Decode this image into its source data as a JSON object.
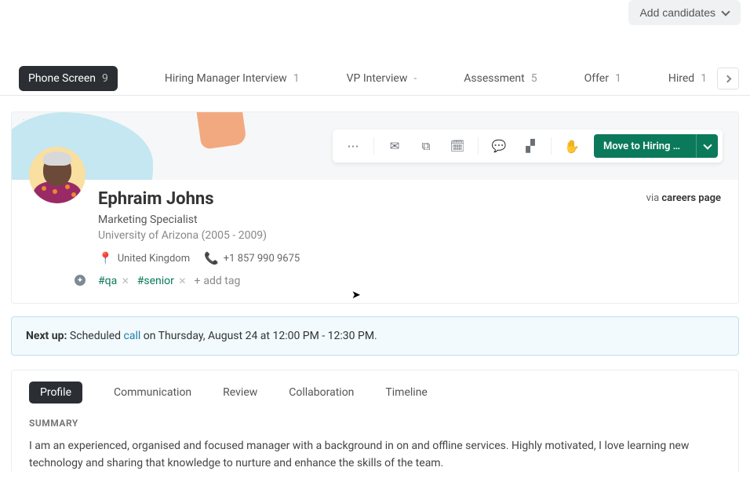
{
  "topbar": {
    "add_candidates_label": "Add candidates"
  },
  "pipeline": {
    "stages": [
      {
        "label": "Phone Screen",
        "count": "9",
        "active": true
      },
      {
        "label": "Hiring Manager Interview",
        "count": "1",
        "active": false
      },
      {
        "label": "VP Interview",
        "count": "-",
        "active": false
      },
      {
        "label": "Assessment",
        "count": "5",
        "active": false
      },
      {
        "label": "Offer",
        "count": "1",
        "active": false
      },
      {
        "label": "Hired",
        "count": "1",
        "active": false
      }
    ]
  },
  "toolbar": {
    "move_label": "Move to Hiring Mana…"
  },
  "candidate": {
    "name": "Ephraim Johns",
    "title": "Marketing Specialist",
    "education": "University of Arizona (2005 - 2009)",
    "location": "United Kingdom",
    "phone": "+1 857 990 9675",
    "via_prefix": "via ",
    "via_source": "careers page",
    "tags": [
      {
        "text": "#qa"
      },
      {
        "text": "#senior"
      }
    ],
    "add_tag_label": "add tag"
  },
  "notice": {
    "prefix": "Next up:",
    "text_before": " Scheduled ",
    "link": "call",
    "text_after": " on Thursday, August 24 at 12:00 PM - 12:30 PM."
  },
  "tabs": {
    "items": [
      {
        "label": "Profile",
        "active": true
      },
      {
        "label": "Communication",
        "active": false
      },
      {
        "label": "Review",
        "active": false
      },
      {
        "label": "Collaboration",
        "active": false
      },
      {
        "label": "Timeline",
        "active": false
      }
    ]
  },
  "profile": {
    "summary_heading": "SUMMARY",
    "summary_text": "I am an experienced, organised and focused manager with a background in on and offline services. Highly motivated, I love learning new technology and sharing that knowledge to nurture and enhance the skills of the team."
  }
}
